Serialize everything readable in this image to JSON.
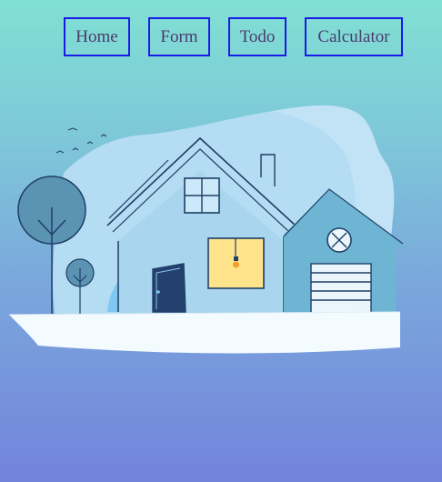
{
  "nav": {
    "items": [
      {
        "label": "Home"
      },
      {
        "label": "Form"
      },
      {
        "label": "Todo"
      },
      {
        "label": "Calculator"
      }
    ]
  },
  "colors": {
    "background_top": "#80e0d3",
    "background_bottom": "#7283dc",
    "nav_border": "#1a1ae8",
    "nav_text": "#4a3b6e",
    "house_body": "#a8d8ef",
    "house_line": "#1f3f66",
    "window_light": "#ffe38a",
    "door": "#24406e",
    "ground": "#f4fbff",
    "garage": "#6fb6d4",
    "tree": "#4f8fb0"
  },
  "illustration": {
    "icon": "house-illustration"
  }
}
